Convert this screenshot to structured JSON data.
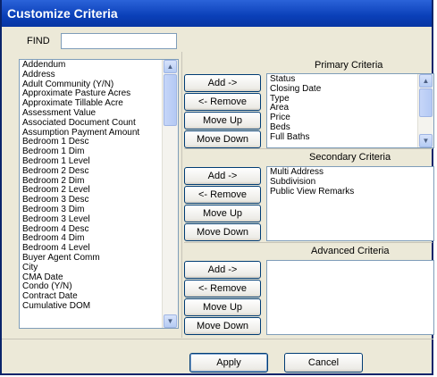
{
  "window": {
    "title": "Customize Criteria"
  },
  "find": {
    "label": "FIND",
    "value": ""
  },
  "fields_list": {
    "items": [
      "Addendum",
      "Address",
      "Adult Community (Y/N)",
      "Approximate Pasture Acres",
      "Approximate Tillable Acre",
      "Assessment Value",
      "Associated Document Count",
      "Assumption Payment Amount",
      "Bedroom 1 Desc",
      "Bedroom 1 Dim",
      "Bedroom 1 Level",
      "Bedroom 2 Desc",
      "Bedroom 2 Dim",
      "Bedroom 2 Level",
      "Bedroom 3 Desc",
      "Bedroom 3 Dim",
      "Bedroom 3 Level",
      "Bedroom 4 Desc",
      "Bedroom 4 Dim",
      "Bedroom 4 Level",
      "Buyer Agent Comm",
      "City",
      "CMA Date",
      "Condo (Y/N)",
      "Contract Date",
      "Cumulative DOM"
    ]
  },
  "primary": {
    "title": "Primary Criteria",
    "items": [
      "Status",
      "Closing Date",
      "Type",
      "Area",
      "Price",
      "Beds",
      "Full Baths"
    ],
    "buttons": {
      "add": "Add ->",
      "remove": "<- Remove",
      "up": "Move Up",
      "down": "Move Down"
    }
  },
  "secondary": {
    "title": "Secondary Criteria",
    "items": [
      "Multi Address",
      "Subdivision",
      "Public View Remarks"
    ],
    "buttons": {
      "add": "Add ->",
      "remove": "<- Remove",
      "up": "Move Up",
      "down": "Move Down"
    }
  },
  "advanced": {
    "title": "Advanced Criteria",
    "items": [],
    "buttons": {
      "add": "Add ->",
      "remove": "<- Remove",
      "up": "Move Up",
      "down": "Move Down"
    }
  },
  "footer": {
    "apply": "Apply",
    "cancel": "Cancel"
  }
}
